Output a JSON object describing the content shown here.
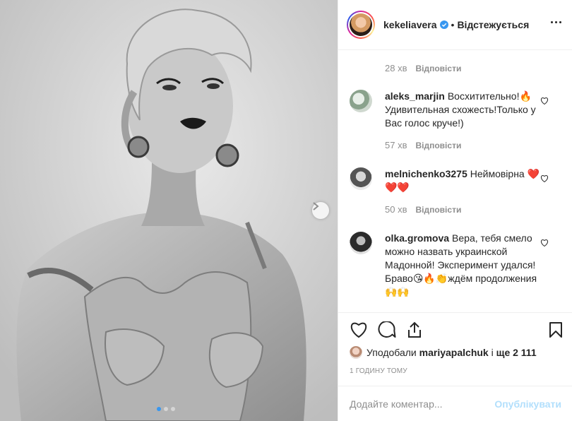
{
  "post": {
    "username": "kekeliavera",
    "follow_state": "Відстежується",
    "separator": "•"
  },
  "top_meta": {
    "time": "28 хв",
    "reply": "Відповісти"
  },
  "comments": [
    {
      "username": "aleks_marjin",
      "text": "Восхитительно!🔥 Удивительная схожесть!Только у Вас голос круче!)",
      "time": "57 хв",
      "reply": "Відповісти"
    },
    {
      "username": "melnichenko3275",
      "text": "Неймовірна ❤️❤️❤️",
      "time": "50 хв",
      "reply": "Відповісти"
    },
    {
      "username": "olka.gromova",
      "text": "Вера, тебя смело можно назвать украинской Мадонной! Эксперимент удался! Браво😘🔥👏ждём продолжения🙌🙌",
      "time": "",
      "reply": ""
    }
  ],
  "likes": {
    "prefix": "Уподобали",
    "user": "mariyapalchuk",
    "middle": "і",
    "others": "ще 2 111"
  },
  "timestamp": "1 ГОДИНУ ТОМУ",
  "add_comment": {
    "placeholder": "Додайте коментар...",
    "post_label": "Опублікувати"
  },
  "carousel": {
    "count": 3,
    "active": 1
  },
  "colors": {
    "accent": "#3897f0",
    "post_disabled": "#b2dffc",
    "heart_red": "#ed4956",
    "muted": "#8e8e8e"
  },
  "icons": [
    "verified-badge-icon",
    "more-options-icon",
    "heart-icon",
    "comment-icon",
    "share-icon",
    "bookmark-icon",
    "chevron-right-icon"
  ]
}
